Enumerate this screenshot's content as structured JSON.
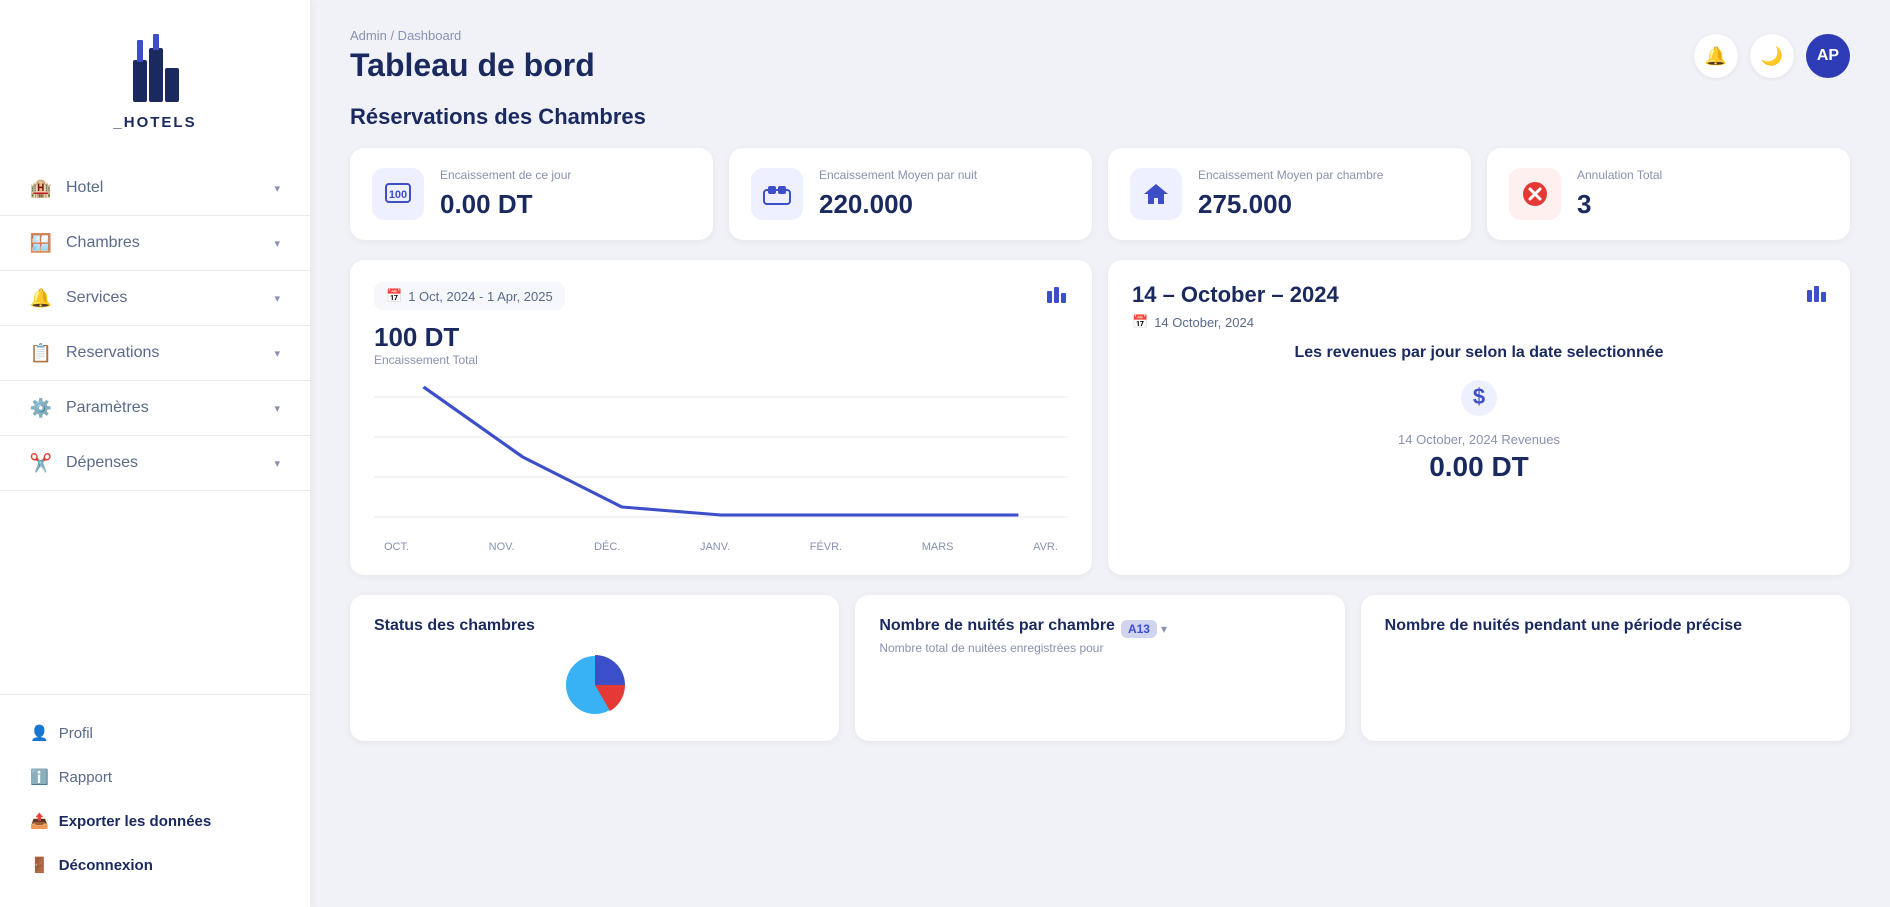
{
  "logo": {
    "text": "_HOTELS"
  },
  "sidebar": {
    "nav_items": [
      {
        "id": "hotel",
        "label": "Hotel",
        "icon": "🏨"
      },
      {
        "id": "chambres",
        "label": "Chambres",
        "icon": "🪟"
      },
      {
        "id": "services",
        "label": "Services",
        "icon": "🔔"
      },
      {
        "id": "reservations",
        "label": "Reservations",
        "icon": "📋"
      },
      {
        "id": "parametres",
        "label": "Paramètres",
        "icon": "⚙️"
      },
      {
        "id": "depenses",
        "label": "Dépenses",
        "icon": "✂️"
      }
    ],
    "bottom_items": [
      {
        "id": "profil",
        "label": "Profil",
        "icon": "👤"
      },
      {
        "id": "rapport",
        "label": "Rapport",
        "icon": "ℹ️"
      },
      {
        "id": "exporter",
        "label": "Exporter les données",
        "icon": "📤",
        "bold": true
      },
      {
        "id": "deconnexion",
        "label": "Déconnexion",
        "icon": "🚪",
        "bold": true
      }
    ]
  },
  "header": {
    "breadcrumb": "Admin / Dashboard",
    "title": "Tableau de bord",
    "avatar_initials": "AP"
  },
  "main": {
    "section_title": "Réservations des Chambres",
    "stat_cards": [
      {
        "id": "encaissement-jour",
        "label": "Encaissement de ce jour",
        "value": "0.00 DT",
        "icon": "💯",
        "icon_type": "blue"
      },
      {
        "id": "encaissement-nuit",
        "label": "Encaissement Moyen par nuit",
        "value": "220.000",
        "icon": "🛏️",
        "icon_type": "blue"
      },
      {
        "id": "encaissement-chambre",
        "label": "Encaissement Moyen par chambre",
        "value": "275.000",
        "icon": "🏠",
        "icon_type": "blue"
      },
      {
        "id": "annulation-total",
        "label": "Annulation Total",
        "value": "3",
        "icon": "❌",
        "icon_type": "red"
      }
    ],
    "chart_left": {
      "date_range": "1 Oct, 2024 - 1 Apr, 2025",
      "amount": "100 DT",
      "sublabel": "Encaissement Total",
      "x_labels": [
        "OCT.",
        "NOV.",
        "DÉC.",
        "JANV.",
        "FÉVR.",
        "MARS",
        "AVR."
      ]
    },
    "chart_right": {
      "title": "14 – October – 2024",
      "date_badge": "14 October, 2024",
      "subtitle": "Les revenues par jour selon la date selectionnée",
      "revenue_label": "14 October, 2024 Revenues",
      "revenue_value": "0.00 DT"
    },
    "bottom_cards": [
      {
        "id": "status-chambres",
        "title": "Status des chambres",
        "subtitle": ""
      },
      {
        "id": "nuitees-chambre",
        "title": "Nombre de nuités par chambre",
        "badge": "A13",
        "subtitle": "Nombre total de nuitées enregistrées pour"
      },
      {
        "id": "nuitees-periode",
        "title": "Nombre de nuités pendant une période précise",
        "subtitle": ""
      }
    ]
  }
}
